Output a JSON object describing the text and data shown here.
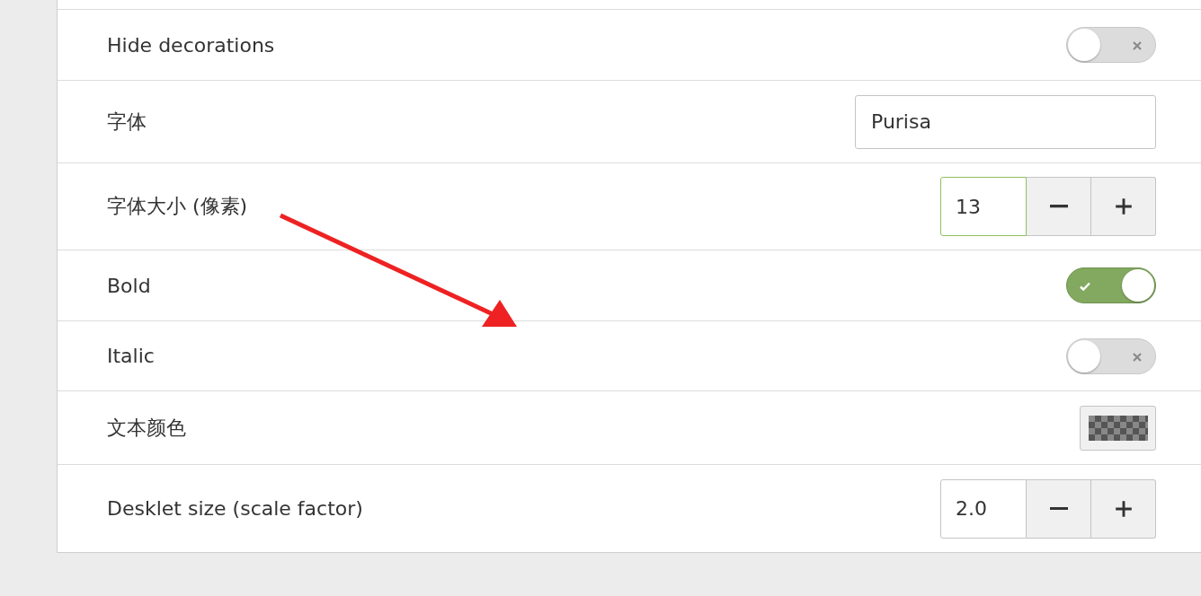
{
  "settings": [
    {
      "kind": "switch",
      "label": "Hide decorations",
      "on": false
    },
    {
      "kind": "entry",
      "label": "字体",
      "value": "Purisa"
    },
    {
      "kind": "spin",
      "label": "字体大小 (像素)",
      "value": "13",
      "focused": true
    },
    {
      "kind": "switch",
      "label": "Bold",
      "on": true
    },
    {
      "kind": "switch",
      "label": "Italic",
      "on": false
    },
    {
      "kind": "color",
      "label": "文本颜色"
    },
    {
      "kind": "spin",
      "label": "Desklet size (scale factor)",
      "value": "2.0",
      "focused": false
    }
  ]
}
